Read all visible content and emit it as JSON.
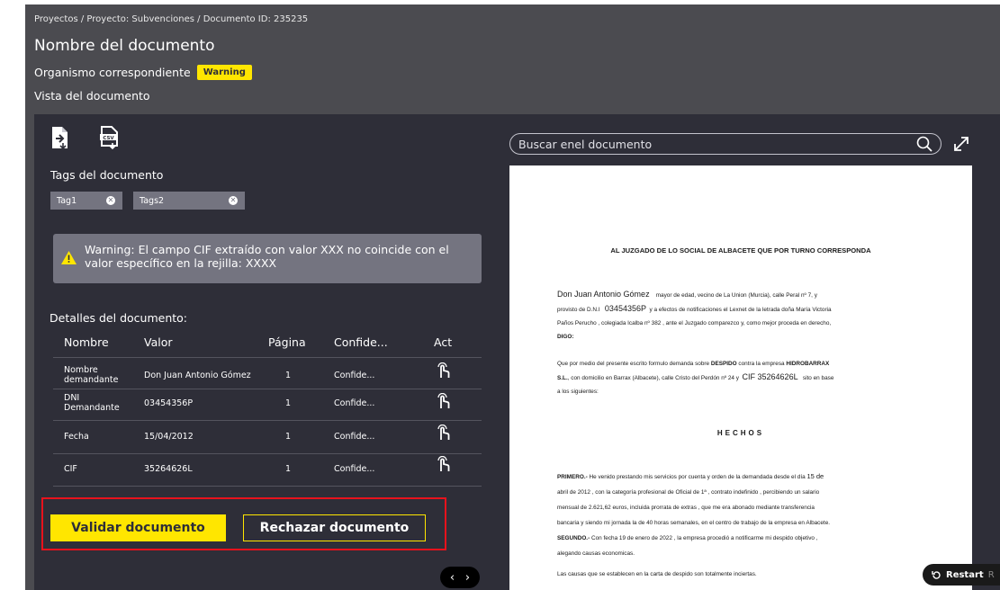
{
  "breadcrumb": "Proyectos / Proyecto: Subvenciones / Documento ID: 235235",
  "document_title": "Nombre del documento",
  "organismo": {
    "label": "Organismo correspondiente",
    "badge": "Warning"
  },
  "vista_label": "Vista del documento",
  "toolbar": {
    "icons": [
      "file-export-icon",
      "csv-export-icon"
    ]
  },
  "tags": {
    "title": "Tags del documento",
    "items": [
      {
        "label": "Tag1"
      },
      {
        "label": "Tags2"
      }
    ]
  },
  "warning": {
    "line1": "Warning: El campo CIF extraído con valor XXX no coincide con el",
    "line2": "valor específico en la rejilla: XXXX"
  },
  "details": {
    "title": "Detalles del documento:",
    "columns": [
      "Nombre",
      "Valor",
      "Página",
      "Confide...",
      "Act"
    ],
    "rows": [
      {
        "nombre_1": "Nombre",
        "nombre_2": "demandante",
        "valor": "Don Juan Antonio Gómez",
        "pagina": "1",
        "confidence": "Confide..."
      },
      {
        "nombre_1": "DNI",
        "nombre_2": "Demandante",
        "valor": "03454356P",
        "pagina": "1",
        "confidence": "Confide..."
      },
      {
        "nombre_1": "Fecha",
        "nombre_2": "",
        "valor": "15/04/2012",
        "pagina": "1",
        "confidence": "Confide..."
      },
      {
        "nombre_1": "CIF",
        "nombre_2": "",
        "valor": "35264626L",
        "pagina": "1",
        "confidence": "Confide..."
      }
    ]
  },
  "actions": {
    "validate": "Validar documento",
    "reject": "Rechazar documento"
  },
  "pager": {
    "prev": "‹",
    "next": "›"
  },
  "search": {
    "placeholder": "Buscar enel documento"
  },
  "document": {
    "heading": "AL JUZGADO DE LO SOCIAL DE ALBACETE QUE POR TURNO CORRESPONDA",
    "p1_name": "Don Juan Antonio Gómez",
    "p1_a": "mayor de edad, vecino de La Union (Murcia), calle Peral nº 7, y",
    "p1_b_pre": "provisto de D.N.I",
    "p1_b_dni": "03454356P",
    "p1_b_post": "y a efectos de notificaciones el Lexnet de la letrada doña María Victoria",
    "p1_c": "Paños Perucho , colegiada Icalba nº 382 , ante el Juzgado comparezco y, como mejor proceda en derecho,",
    "p1_d": "DIGO:",
    "p2_a_pre": "Que por medio del presente escrito formulo demanda sobre",
    "p2_a_b1": "DESPIDO",
    "p2_a_mid": "contra la empresa",
    "p2_a_b2": "HIDROBARRAX",
    "p2_b_b": "S.L.",
    "p2_b_pre": ", con domicilio en Barrax (Albacete), calle Cristo del Perdón nº 24 y",
    "p2_b_cif": "CIF 35264626L",
    "p2_b_post": "sito en base",
    "p2_c": "a los siguientes:",
    "hechos": "HECHOS",
    "p3_a_b": "PRIMERO.-",
    "p3_a": "He venido prestando mis servicios por cuenta y orden de la demandada desde el día",
    "p3_a_date": "15 de",
    "p3_b": "abril de 2012 , con la categoría profesional de Oficial de 1ª , contrato indefinido , percibiendo un salario",
    "p3_c": "mensual de 2.621,62 euros, incluida prorrata de extras , que me era abonado mediante transferencia",
    "p3_d": "bancaria y siendo mi jornada la de 40 horas semanales, en el centro de trabajo de la empresa en Albacete.",
    "p4_a_b": "SEGUNDO.-",
    "p4_a": "Con fecha 19 de enero de 2022 , la empresa procedió a notificarme mi despido objetivo ,",
    "p4_b": "alegando causas economicas.",
    "p5": "Las causas que se establecen en la carta de despido son totalmente inciertas."
  },
  "restart": {
    "label": "Restart",
    "tail": "R"
  },
  "colors": {
    "accent": "#ffe600",
    "panel": "#2e2e38",
    "header": "#4b4b50",
    "highlight_frame": "#e8121c"
  }
}
